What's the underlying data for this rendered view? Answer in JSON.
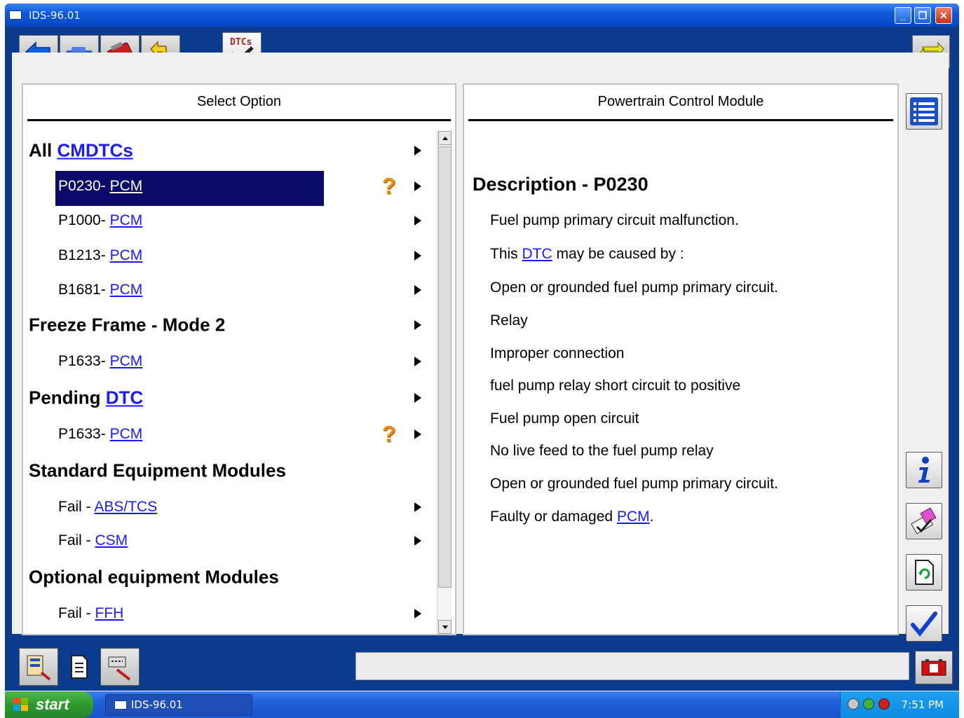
{
  "window": {
    "title": "IDS-96.01",
    "controls": [
      "minimize",
      "restore",
      "close"
    ]
  },
  "toolbar": {
    "buttons": [
      {
        "icon": "back-arrow-icon"
      },
      {
        "icon": "vehicle-icon"
      },
      {
        "icon": "toolbox-icon"
      },
      {
        "icon": "yellow-arrow-icon"
      },
      {
        "icon": "dtcs-tab-icon",
        "label": "DTCs"
      }
    ],
    "right_icon": "swap-arrows-icon"
  },
  "left_panel": {
    "header": "Select Option",
    "rows": [
      {
        "type": "heading",
        "prefix": "All ",
        "link": "CMDTCs",
        "arrow": true
      },
      {
        "type": "item",
        "prefix": "P0230- ",
        "link": "PCM",
        "arrow": true,
        "selected": true,
        "help": true
      },
      {
        "type": "item",
        "prefix": "P1000- ",
        "link": "PCM",
        "arrow": true
      },
      {
        "type": "item",
        "prefix": "B1213- ",
        "link": "PCM",
        "arrow": true
      },
      {
        "type": "item",
        "prefix": "B1681- ",
        "link": "PCM",
        "arrow": true
      },
      {
        "type": "heading",
        "prefix": "Freeze Frame - Mode 2",
        "link": "",
        "arrow": true
      },
      {
        "type": "item",
        "prefix": "P1633- ",
        "link": "PCM",
        "arrow": true
      },
      {
        "type": "heading",
        "prefix": "Pending ",
        "link": "DTC",
        "arrow": true
      },
      {
        "type": "item",
        "prefix": "P1633- ",
        "link": "PCM",
        "arrow": true,
        "help": true
      },
      {
        "type": "heading",
        "prefix": "Standard Equipment Modules",
        "link": "",
        "arrow": false
      },
      {
        "type": "item",
        "prefix": "Fail - ",
        "link": "ABS/TCS",
        "arrow": true
      },
      {
        "type": "item",
        "prefix": "Fail - ",
        "link": "CSM",
        "arrow": true
      },
      {
        "type": "heading",
        "prefix": "Optional equipment Modules",
        "link": "",
        "arrow": false
      },
      {
        "type": "item",
        "prefix": "Fail - ",
        "link": "FFH",
        "arrow": true
      }
    ]
  },
  "right_panel": {
    "header": "Powertrain Control Module",
    "desc_title": "Description - P0230",
    "lines": [
      {
        "pre": "Fuel pump primary circuit malfunction.",
        "link": "",
        "post": ""
      },
      {
        "pre": "This ",
        "link": "DTC",
        "post": " may be caused by :"
      },
      {
        "pre": "Open or grounded fuel pump primary circuit.",
        "link": "",
        "post": ""
      },
      {
        "pre": "Relay",
        "link": "",
        "post": ""
      },
      {
        "pre": "Improper connection",
        "link": "",
        "post": ""
      },
      {
        "pre": "fuel pump relay short circuit to positive",
        "link": "",
        "post": ""
      },
      {
        "pre": "Fuel pump open circuit",
        "link": "",
        "post": ""
      },
      {
        "pre": "No live feed to the fuel pump relay",
        "link": "",
        "post": ""
      },
      {
        "pre": "Open or grounded fuel pump primary circuit.",
        "link": "",
        "post": ""
      },
      {
        "pre": "Faulty or damaged ",
        "link": "PCM",
        "post": "."
      }
    ]
  },
  "side_buttons": [
    "list-icon",
    "info-icon",
    "eraser-icon",
    "page-refresh-icon",
    "checkmark-icon"
  ],
  "bottom_buttons": [
    "session-icon",
    "document-icon",
    "cable-icon"
  ],
  "bottom_right_icon": "battery-icon",
  "taskbar": {
    "start_label": "start",
    "task_label": "IDS-96.01",
    "clock": "7:51 PM"
  },
  "colors": {
    "frame_blue": "#0b3b8c",
    "selection": "#0a0a6a",
    "link": "#1a1aff",
    "xp_green": "#2e9a2e"
  }
}
